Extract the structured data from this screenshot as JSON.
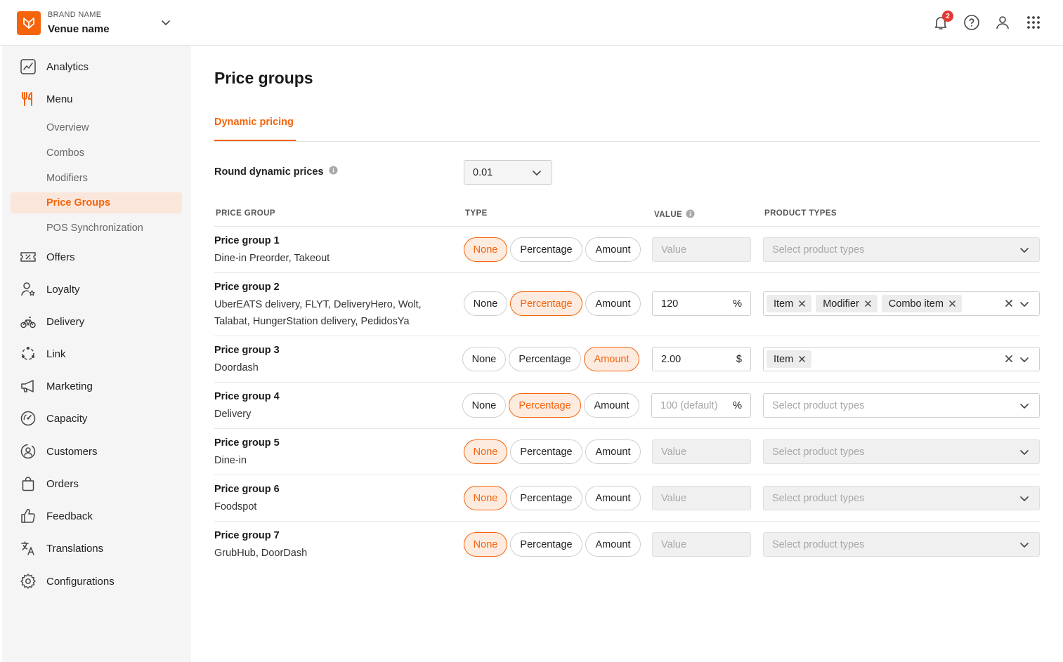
{
  "header": {
    "brand_name": "BRAND NAME",
    "venue_name": "Venue name",
    "notification_count": "2"
  },
  "sidebar": {
    "items": [
      {
        "label": "Analytics",
        "icon": "analytics-icon"
      },
      {
        "label": "Menu",
        "icon": "fork-knife-icon"
      },
      {
        "label": "Offers",
        "icon": "ticket-icon"
      },
      {
        "label": "Loyalty",
        "icon": "loyalty-icon"
      },
      {
        "label": "Delivery",
        "icon": "bike-icon"
      },
      {
        "label": "Link",
        "icon": "link-icon"
      },
      {
        "label": "Marketing",
        "icon": "megaphone-icon"
      },
      {
        "label": "Capacity",
        "icon": "gauge-icon"
      },
      {
        "label": "Customers",
        "icon": "customers-icon"
      },
      {
        "label": "Orders",
        "icon": "bag-icon"
      },
      {
        "label": "Feedback",
        "icon": "thumbs-up-icon"
      },
      {
        "label": "Translations",
        "icon": "translate-icon"
      },
      {
        "label": "Configurations",
        "icon": "gear-icon"
      }
    ],
    "menu_sub": [
      {
        "label": "Overview"
      },
      {
        "label": "Combos"
      },
      {
        "label": "Modifiers"
      },
      {
        "label": "Price Groups",
        "active": true
      },
      {
        "label": "POS Synchronization"
      }
    ]
  },
  "main": {
    "title": "Price groups",
    "tab": "Dynamic pricing",
    "round_label": "Round dynamic prices",
    "round_value": "0.01",
    "columns": {
      "price_group": "PRICE GROUP",
      "type": "TYPE",
      "value": "VALUE",
      "product_types": "PRODUCT TYPES"
    },
    "type_options": [
      "None",
      "Percentage",
      "Amount"
    ],
    "value_placeholder": "Value",
    "product_types_placeholder": "Select product types",
    "rows": [
      {
        "name": "Price group 1",
        "desc": "Dine-in Preorder, Takeout",
        "type": "None",
        "value": "",
        "unit": "",
        "chips": []
      },
      {
        "name": "Price group 2",
        "desc": "UberEATS delivery, FLYT, DeliveryHero, Wolt, Talabat, HungerStation delivery, PedidosYa",
        "type": "Percentage",
        "value": "120",
        "unit": "%",
        "chips": [
          "Item",
          "Modifier",
          "Combo item"
        ]
      },
      {
        "name": "Price group 3",
        "desc": "Doordash",
        "type": "Amount",
        "value": "2.00",
        "unit": "$",
        "chips": [
          "Item"
        ]
      },
      {
        "name": "Price group 4",
        "desc": "Delivery",
        "type": "Percentage",
        "value": "",
        "value_placeholder": "100 (default)",
        "unit": "%",
        "chips": []
      },
      {
        "name": "Price group 5",
        "desc": "Dine-in",
        "type": "None",
        "value": "",
        "unit": "",
        "chips": []
      },
      {
        "name": "Price group 6",
        "desc": "Foodspot",
        "type": "None",
        "value": "",
        "unit": "",
        "chips": []
      },
      {
        "name": "Price group 7",
        "desc": "GrubHub, DoorDash",
        "type": "None",
        "value": "",
        "unit": "",
        "chips": []
      }
    ]
  },
  "colors": {
    "accent": "#f5640a",
    "accent_bg": "#fdebe0",
    "badge": "#e53935"
  }
}
